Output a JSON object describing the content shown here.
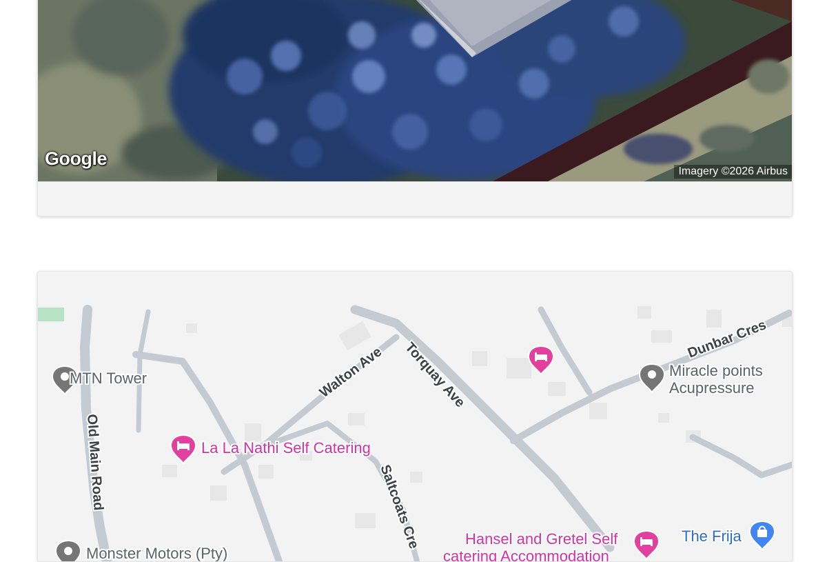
{
  "satellite_map": {
    "logo": "Google",
    "attribution": "Imagery ©2026 Airbus"
  },
  "road_map": {
    "streets": {
      "walton_ave": "Walton Ave",
      "torquay_ave": "Torquay Ave",
      "dunbar_cres": "Dunbar Cres",
      "old_main_road": "Old Main Road",
      "saltcoats_cres": "Saltcoats Cre"
    },
    "places": [
      {
        "name": "MTN Tower",
        "category": "generic-place",
        "color": "#757575"
      },
      {
        "name": "Miracle points",
        "name_line2": "Acupressure",
        "category": "generic-place",
        "color": "#757575"
      },
      {
        "name": "La La Nathi Self Catering",
        "category": "lodging",
        "color": "#e23f9e"
      },
      {
        "name": "Hansel and Gretel Self",
        "name_line2": "catering Accommodation",
        "category": "lodging",
        "color": "#e23f9e"
      },
      {
        "name": "The Frija",
        "category": "shopping",
        "color": "#4285f4"
      },
      {
        "name": "Monster Motors (Pty)",
        "category": "generic-place",
        "color": "#757575"
      }
    ],
    "unlabeled_pin": {
      "category": "lodging",
      "color": "#e23f9e"
    }
  }
}
